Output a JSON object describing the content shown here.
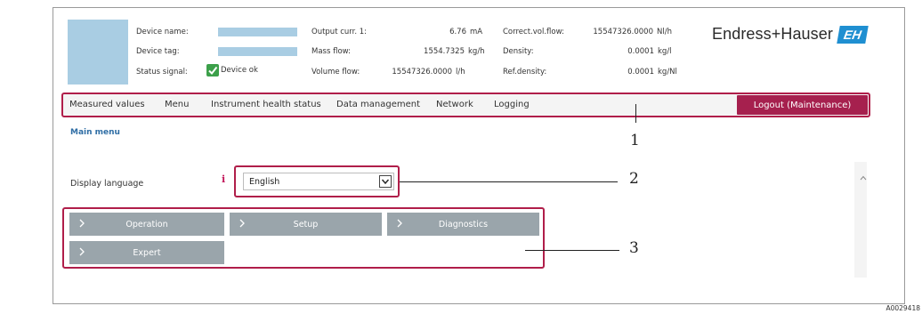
{
  "header": {
    "device_name_label": "Device name:",
    "device_tag_label": "Device tag:",
    "status_signal_label": "Status signal:",
    "status_signal_value": "Device ok",
    "output_curr_label": "Output curr. 1:",
    "output_curr_value": "6.76",
    "output_curr_unit": "mA",
    "mass_flow_label": "Mass flow:",
    "mass_flow_value": "1554.7325",
    "mass_flow_unit": "kg/h",
    "volume_flow_label": "Volume flow:",
    "volume_flow_value": "15547326.0000",
    "volume_flow_unit": "l/h",
    "corr_vol_flow_label": "Correct.vol.flow:",
    "corr_vol_flow_value": "15547326.0000",
    "corr_vol_flow_unit": "Nl/h",
    "density_label": "Density:",
    "density_value": "0.0001",
    "density_unit": "kg/l",
    "ref_density_label": "Ref.density:",
    "ref_density_value": "0.0001",
    "ref_density_unit": "kg/Nl"
  },
  "logo": {
    "name": "Endress+Hauser",
    "mark": "EH",
    "brand_color": "#1f8fd1"
  },
  "nav": {
    "items": [
      "Measured values",
      "Menu",
      "Instrument health status",
      "Data management",
      "Network",
      "Logging"
    ],
    "logout": "Logout (Maintenance)",
    "accent": "#a6204e"
  },
  "main": {
    "breadcrumb": "Main menu",
    "language_label": "Display language",
    "language_value": "English",
    "tiles": [
      "Operation",
      "Setup",
      "Diagnostics",
      "Expert"
    ]
  },
  "callouts": [
    "1",
    "2",
    "3"
  ],
  "figure_id": "A0029418"
}
